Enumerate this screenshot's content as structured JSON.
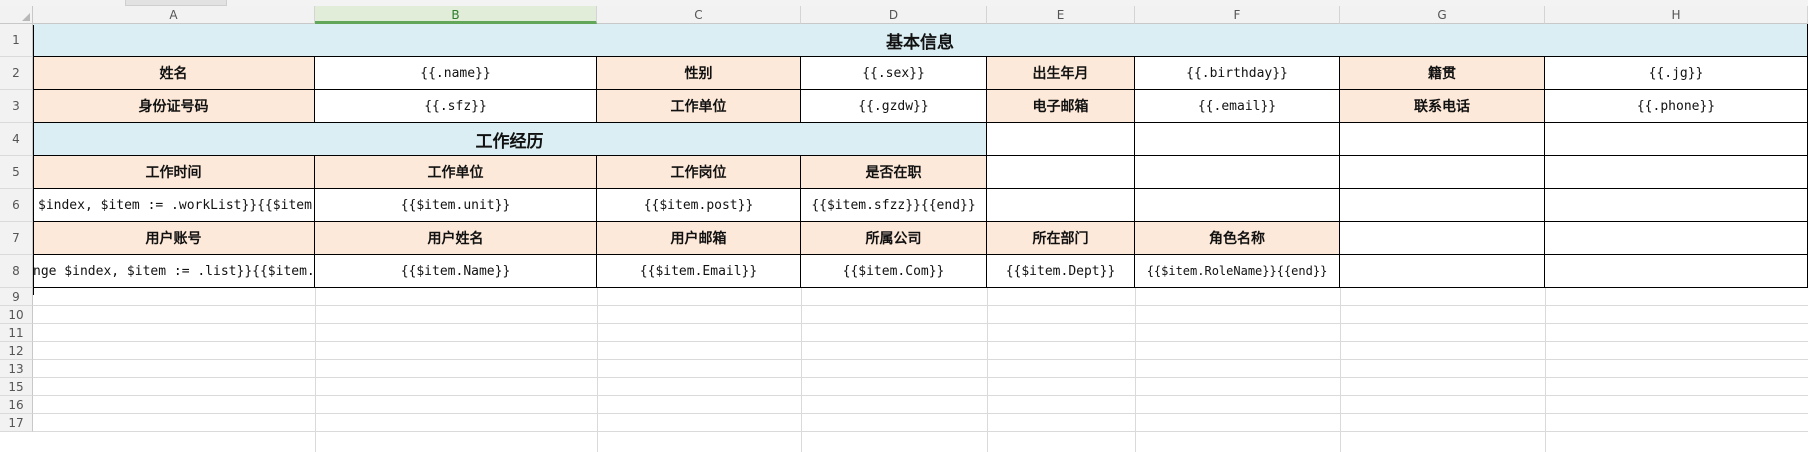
{
  "columns": [
    "A",
    "B",
    "C",
    "D",
    "E",
    "F",
    "G",
    "H"
  ],
  "rows": [
    "1",
    "2",
    "3",
    "4",
    "5",
    "6",
    "7",
    "8",
    "9",
    "10",
    "11",
    "12",
    "13",
    "15",
    "16",
    "17"
  ],
  "selected_column": "B",
  "colors": {
    "title_fill": "#dbeef3",
    "label_fill": "#fde9d9",
    "selected_header": "#e1ecd9"
  },
  "sheet": {
    "basic_info_title": "基本信息",
    "name_label": "姓名",
    "name_value": "{{.name}}",
    "sex_label": "性别",
    "sex_value": "{{.sex}}",
    "birthday_label": "出生年月",
    "birthday_value": "{{.birthday}}",
    "jg_label": "籍贯",
    "jg_value": "{{.jg}}",
    "sfz_label": "身份证号码",
    "sfz_value": "{{.sfz}}",
    "gzdw_label": "工作单位",
    "gzdw_value": "{{.gzdw}}",
    "email_label": "电子邮箱",
    "email_value": "{{.email}}",
    "phone_label": "联系电话",
    "phone_value": "{{.phone}}",
    "work_title": "工作经历",
    "work_headers": [
      "工作时间",
      "工作单位",
      "工作岗位",
      "是否在职"
    ],
    "work_row": [
      "$index, $item := .workList}}{{$item",
      "{{$item.unit}}",
      "{{$item.post}}",
      "{{$item.sfzz}}{{end}}"
    ],
    "user_headers": [
      "用户账号",
      "用户姓名",
      "用户邮箱",
      "所属公司",
      "所在部门",
      "角色名称"
    ],
    "user_row": [
      "nge $index, $item := .list}}{{$item.",
      "{{$item.Name}}",
      "{{$item.Email}}",
      "{{$item.Com}}",
      "{{$item.Dept}}",
      "{{$item.RoleName}}{{end}}"
    ]
  }
}
